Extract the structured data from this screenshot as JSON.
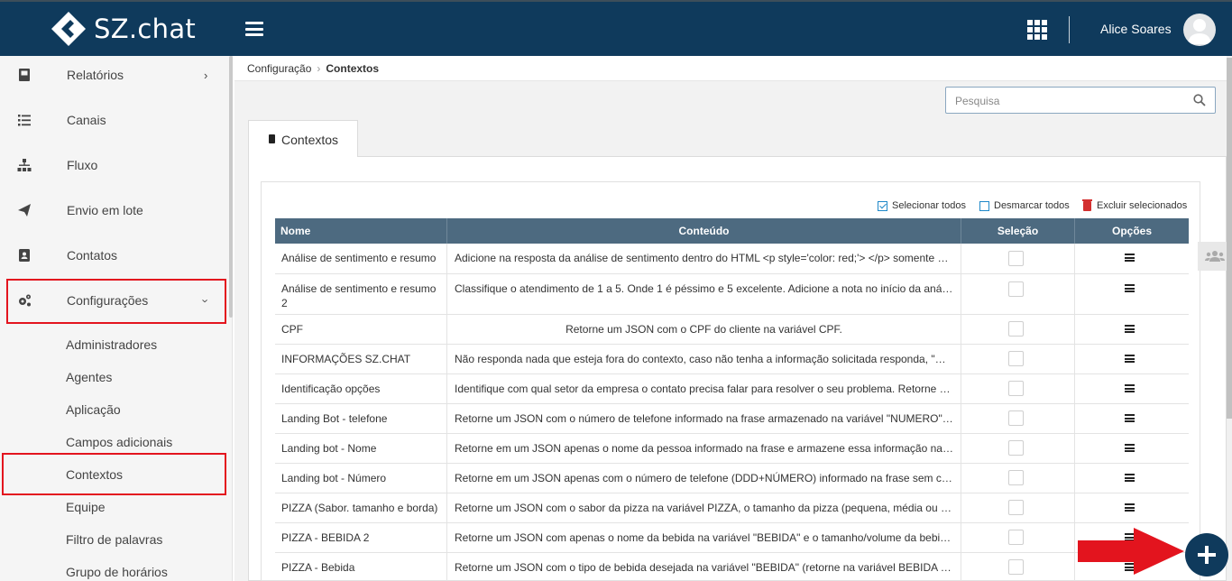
{
  "header": {
    "brand": "SZ.chat",
    "user_name": "Alice Soares",
    "colors": {
      "topbar": "#0f3a5c",
      "highlight_box": "#e3141e"
    }
  },
  "sidebar": {
    "items": [
      {
        "label": "Relatórios",
        "icon": "book-icon"
      },
      {
        "label": "Canais",
        "icon": "list-icon"
      },
      {
        "label": "Fluxo",
        "icon": "sitemap-icon"
      },
      {
        "label": "Envio em lote",
        "icon": "paper-plane-icon"
      },
      {
        "label": "Contatos",
        "icon": "contact-book-icon"
      },
      {
        "label": "Configurações",
        "icon": "gears-icon"
      }
    ],
    "subitems": [
      "Administradores",
      "Agentes",
      "Aplicação",
      "Campos adicionais",
      "Contextos",
      "Equipe",
      "Filtro de palavras",
      "Grupo de horários"
    ]
  },
  "breadcrumb": {
    "parent": "Configuração",
    "current": "Contextos"
  },
  "search": {
    "placeholder": "Pesquisa"
  },
  "tab": {
    "label": "Contextos"
  },
  "actions": {
    "select_all": "Selecionar todos",
    "deselect_all": "Desmarcar todos",
    "delete_selected": "Excluir selecionados"
  },
  "table": {
    "headers": {
      "name": "Nome",
      "content": "Conteúdo",
      "selection": "Seleção",
      "options": "Opções"
    },
    "rows": [
      {
        "name": "Análise de sentimento e resumo",
        "content": "Adicione na resposta da análise de sentimento dentro do HTML <p style='color: red;'> </p> somente sentimento"
      },
      {
        "name": "Análise de sentimento e resumo 2",
        "content": "Classifique o atendimento de 1 a 5. Onde 1 é péssimo e 5 excelente. Adicione a nota no início da análise"
      },
      {
        "name": "CPF",
        "content": "Retorne um JSON com o CPF do cliente na variável CPF."
      },
      {
        "name": "INFORMAÇÕES SZ.CHAT",
        "content": "Não responda nada que esteja fora do contexto, caso não tenha a informação solicitada responda, \"Desculpe\""
      },
      {
        "name": "Identificação opções",
        "content": "Identifique com qual setor da empresa o contato precisa falar para resolver o seu problema. Retorne apenas"
      },
      {
        "name": "Landing Bot - telefone",
        "content": "Retorne um JSON com o número de telefone informado na frase armazenado na variável \"NUMERO\" e mais"
      },
      {
        "name": "Landing bot - Nome",
        "content": "Retorne em um JSON apenas o nome da pessoa informado na frase e armazene essa informação na variável"
      },
      {
        "name": "Landing bot - Número",
        "content": "Retorne em um JSON apenas com o número de telefone (DDD+NÚMERO) informado na frase sem caracteres"
      },
      {
        "name": "PIZZA (Sabor. tamanho e borda)",
        "content": "Retorne um JSON com o sabor da pizza na variável PIZZA, o tamanho da pizza (pequena, média ou grande)"
      },
      {
        "name": "PIZZA - BEBIDA 2",
        "content": "Retorne um JSON com apenas o nome da bebida na variável \"BEBIDA\" e o tamanho/volume da bebida na variável"
      },
      {
        "name": "PIZZA - Bebida",
        "content": "Retorne um JSON com o tipo de bebida desejada na variável \"BEBIDA\" (retorne na variável BEBIDA as informações"
      }
    ]
  }
}
